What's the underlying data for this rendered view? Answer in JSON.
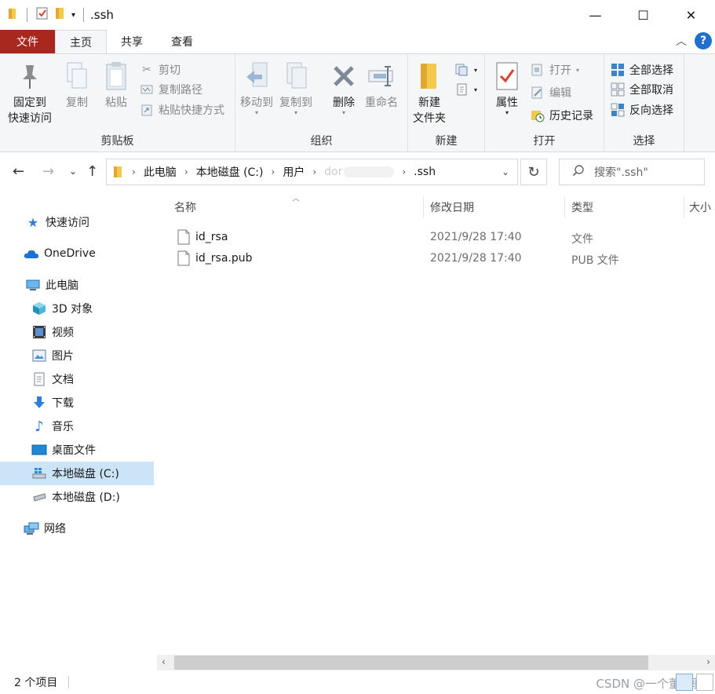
{
  "window": {
    "title": ".ssh",
    "controls": {
      "minimize": "—",
      "maximize": "☐",
      "close": "✕"
    }
  },
  "ribbon_tabs": {
    "file": "文件",
    "home": "主页",
    "share": "共享",
    "view": "查看",
    "help": "?"
  },
  "ribbon": {
    "clipboard": {
      "label": "剪贴板",
      "pin": [
        "固定到",
        "快速访问"
      ],
      "copy": "复制",
      "paste": "粘贴",
      "cut": "剪切",
      "copy_path": "复制路径",
      "paste_shortcut": "粘贴快捷方式"
    },
    "organize": {
      "label": "组织",
      "move_to": "移动到",
      "copy_to": "复制到",
      "delete": "删除",
      "rename": "重命名"
    },
    "new": {
      "label": "新建",
      "new_folder": [
        "新建",
        "文件夹"
      ]
    },
    "open": {
      "label": "打开",
      "properties": "属性",
      "open": "打开",
      "edit": "编辑",
      "history": "历史记录"
    },
    "select": {
      "label": "选择",
      "select_all": "全部选择",
      "select_none": "全部取消",
      "invert": "反向选择"
    }
  },
  "address": {
    "crumbs": [
      "此电脑",
      "本地磁盘 (C:)",
      "用户",
      "dor",
      ".ssh"
    ],
    "search_placeholder": "搜索\".ssh\""
  },
  "nav": {
    "quick_access": "快速访问",
    "onedrive": "OneDrive",
    "this_pc": "此电脑",
    "objects3d": "3D 对象",
    "videos": "视频",
    "pictures": "图片",
    "documents": "文档",
    "downloads": "下载",
    "music": "音乐",
    "desktop": "桌面文件",
    "drive_c": "本地磁盘 (C:)",
    "drive_d": "本地磁盘 (D:)",
    "network": "网络"
  },
  "columns": {
    "name": "名称",
    "modified": "修改日期",
    "type": "类型",
    "size": "大小"
  },
  "files": [
    {
      "name": "id_rsa",
      "modified": "2021/9/28 17:40",
      "type": "文件"
    },
    {
      "name": "id_rsa.pub",
      "modified": "2021/9/28 17:40",
      "type": "PUB 文件"
    }
  ],
  "status": {
    "count": "2 个项目",
    "watermark": "CSDN @一个董懿骢"
  },
  "colors": {
    "file_tab": "#a8271f",
    "selection": "#cce4f7",
    "help": "#1f6fd1",
    "folder": "#f2c94c"
  }
}
